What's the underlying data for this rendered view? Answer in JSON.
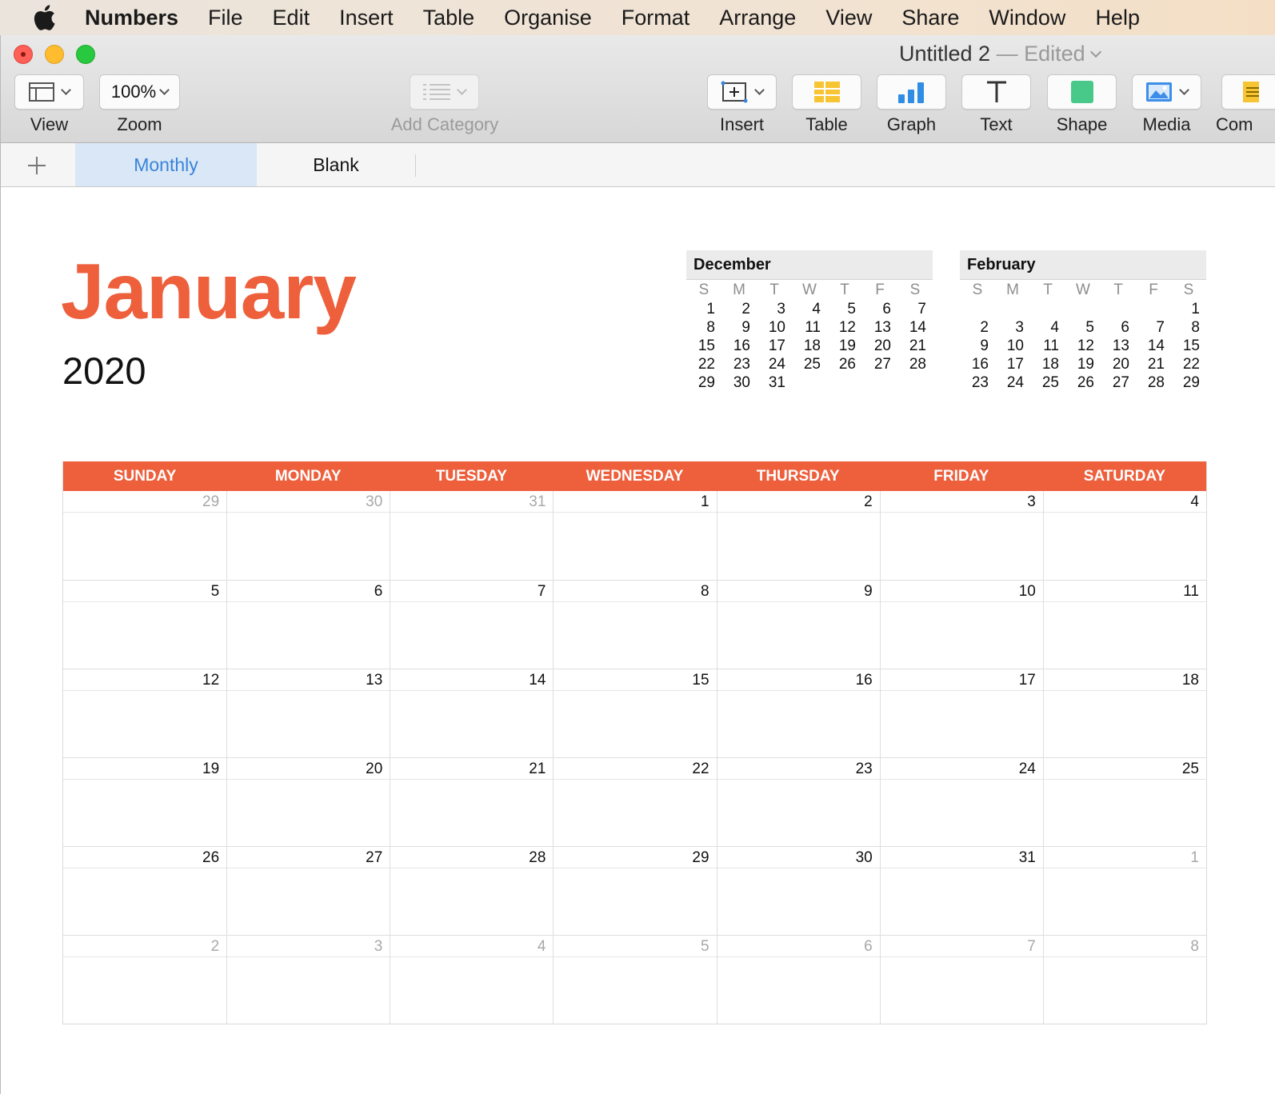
{
  "menubar": {
    "app": "Numbers",
    "items": [
      "File",
      "Edit",
      "Insert",
      "Table",
      "Organise",
      "Format",
      "Arrange",
      "View",
      "Share",
      "Window",
      "Help"
    ]
  },
  "window": {
    "title": "Untitled 2",
    "status": "— Edited"
  },
  "toolbar": {
    "view_label": "View",
    "zoom_value": "100%",
    "zoom_label": "Zoom",
    "add_category_label": "Add Category",
    "insert_label": "Insert",
    "table_label": "Table",
    "graph_label": "Graph",
    "text_label": "Text",
    "shape_label": "Shape",
    "media_label": "Media",
    "comment_label": "Com"
  },
  "sheets": {
    "tabs": [
      {
        "label": "Monthly",
        "active": true
      },
      {
        "label": "Blank",
        "active": false
      }
    ]
  },
  "calendar": {
    "month": "January",
    "year": "2020",
    "accent": "#ee5f3c",
    "weekdays": [
      "SUNDAY",
      "MONDAY",
      "TUESDAY",
      "WEDNESDAY",
      "THURSDAY",
      "FRIDAY",
      "SATURDAY"
    ],
    "weeks": [
      [
        {
          "d": "29",
          "o": true
        },
        {
          "d": "30",
          "o": true
        },
        {
          "d": "31",
          "o": true
        },
        {
          "d": "1"
        },
        {
          "d": "2"
        },
        {
          "d": "3"
        },
        {
          "d": "4"
        }
      ],
      [
        {
          "d": "5"
        },
        {
          "d": "6"
        },
        {
          "d": "7"
        },
        {
          "d": "8"
        },
        {
          "d": "9"
        },
        {
          "d": "10"
        },
        {
          "d": "11"
        }
      ],
      [
        {
          "d": "12"
        },
        {
          "d": "13"
        },
        {
          "d": "14"
        },
        {
          "d": "15"
        },
        {
          "d": "16"
        },
        {
          "d": "17"
        },
        {
          "d": "18"
        }
      ],
      [
        {
          "d": "19"
        },
        {
          "d": "20"
        },
        {
          "d": "21"
        },
        {
          "d": "22"
        },
        {
          "d": "23"
        },
        {
          "d": "24"
        },
        {
          "d": "25"
        }
      ],
      [
        {
          "d": "26"
        },
        {
          "d": "27"
        },
        {
          "d": "28"
        },
        {
          "d": "29"
        },
        {
          "d": "30"
        },
        {
          "d": "31"
        },
        {
          "d": "1",
          "o": true
        }
      ],
      [
        {
          "d": "2",
          "o": true
        },
        {
          "d": "3",
          "o": true
        },
        {
          "d": "4",
          "o": true
        },
        {
          "d": "5",
          "o": true
        },
        {
          "d": "6",
          "o": true
        },
        {
          "d": "7",
          "o": true
        },
        {
          "d": "8",
          "o": true
        }
      ]
    ]
  },
  "mini_calendars": [
    {
      "name": "December",
      "dow": [
        "S",
        "M",
        "T",
        "W",
        "T",
        "F",
        "S"
      ],
      "weeks": [
        [
          "1",
          "2",
          "3",
          "4",
          "5",
          "6",
          "7"
        ],
        [
          "8",
          "9",
          "10",
          "11",
          "12",
          "13",
          "14"
        ],
        [
          "15",
          "16",
          "17",
          "18",
          "19",
          "20",
          "21"
        ],
        [
          "22",
          "23",
          "24",
          "25",
          "26",
          "27",
          "28"
        ],
        [
          "29",
          "30",
          "31",
          "",
          "",
          "",
          ""
        ]
      ]
    },
    {
      "name": "February",
      "dow": [
        "S",
        "M",
        "T",
        "W",
        "T",
        "F",
        "S"
      ],
      "weeks": [
        [
          "",
          "",
          "",
          "",
          "",
          "",
          "1"
        ],
        [
          "2",
          "3",
          "4",
          "5",
          "6",
          "7",
          "8"
        ],
        [
          "9",
          "10",
          "11",
          "12",
          "13",
          "14",
          "15"
        ],
        [
          "16",
          "17",
          "18",
          "19",
          "20",
          "21",
          "22"
        ],
        [
          "23",
          "24",
          "25",
          "26",
          "27",
          "28",
          "29"
        ]
      ]
    }
  ]
}
